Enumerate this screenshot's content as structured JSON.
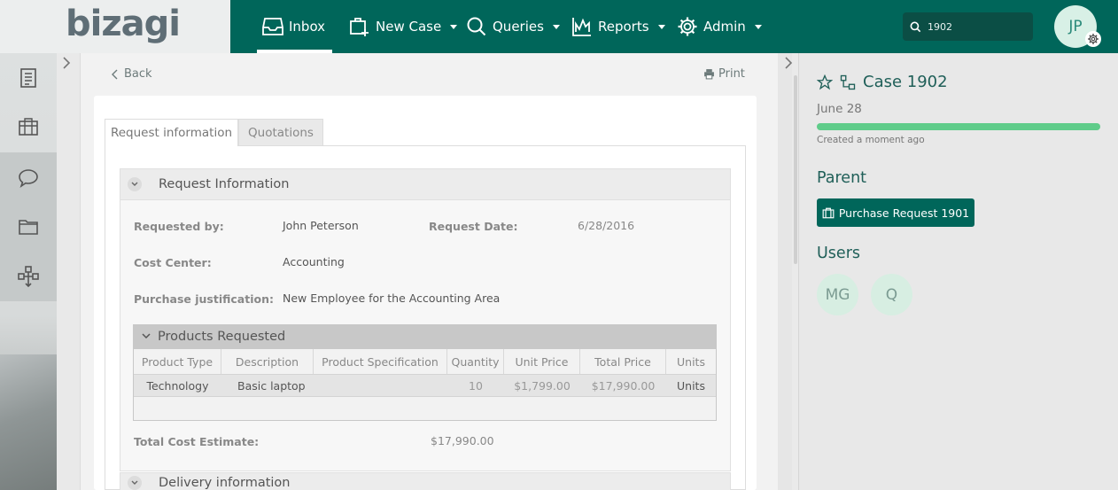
{
  "brand": {
    "logo_text": "bizagi"
  },
  "nav": {
    "items": [
      {
        "label": "Inbox",
        "icon": "inbox-icon"
      },
      {
        "label": "New Case",
        "icon": "new-case-icon"
      },
      {
        "label": "Queries",
        "icon": "search-icon"
      },
      {
        "label": "Reports",
        "icon": "chart-icon"
      },
      {
        "label": "Admin",
        "icon": "gear-icon"
      }
    ],
    "search_value": "1902",
    "user_initials": "JP"
  },
  "sidebar": {
    "items": [
      "document-icon",
      "briefcase-icon",
      "chat-icon",
      "folder-icon",
      "process-icon"
    ]
  },
  "toolbar": {
    "back_label": "Back",
    "print_label": "Print"
  },
  "tabs": [
    {
      "label": "Request information",
      "active": true
    },
    {
      "label": "Quotations",
      "active": false
    }
  ],
  "form": {
    "section_title": "Request Information",
    "requested_by_label": "Requested by:",
    "requested_by_value": "John Peterson",
    "request_date_label": "Request Date:",
    "request_date_value": "6/28/2016",
    "cost_center_label": "Cost Center:",
    "cost_center_value": "Accounting",
    "justification_label": "Purchase justification:",
    "justification_value": "New Employee for the Accounting Area",
    "products": {
      "title": "Products Requested",
      "columns": [
        "Product Type",
        "Description",
        "Product Specification",
        "Quantity",
        "Unit Price",
        "Total Price",
        "Units"
      ],
      "rows": [
        [
          "Technology",
          "Basic laptop",
          "",
          "10",
          "$1,799.00",
          "$17,990.00",
          "Units"
        ]
      ]
    },
    "total_label": "Total Cost Estimate:",
    "total_value": "$17,990.00",
    "next_section_title": "Delivery information"
  },
  "case": {
    "title": "Case 1902",
    "date": "June 28",
    "progress": 1.0,
    "created": "Created a moment ago",
    "parent_heading": "Parent",
    "parent_button": "Purchase Request 1901",
    "users_heading": "Users",
    "users": [
      "MG",
      "Q"
    ]
  },
  "colors": {
    "primary": "#00665a",
    "progress": "#5fcc8a",
    "avatar_bg": "#d8f0e6"
  }
}
